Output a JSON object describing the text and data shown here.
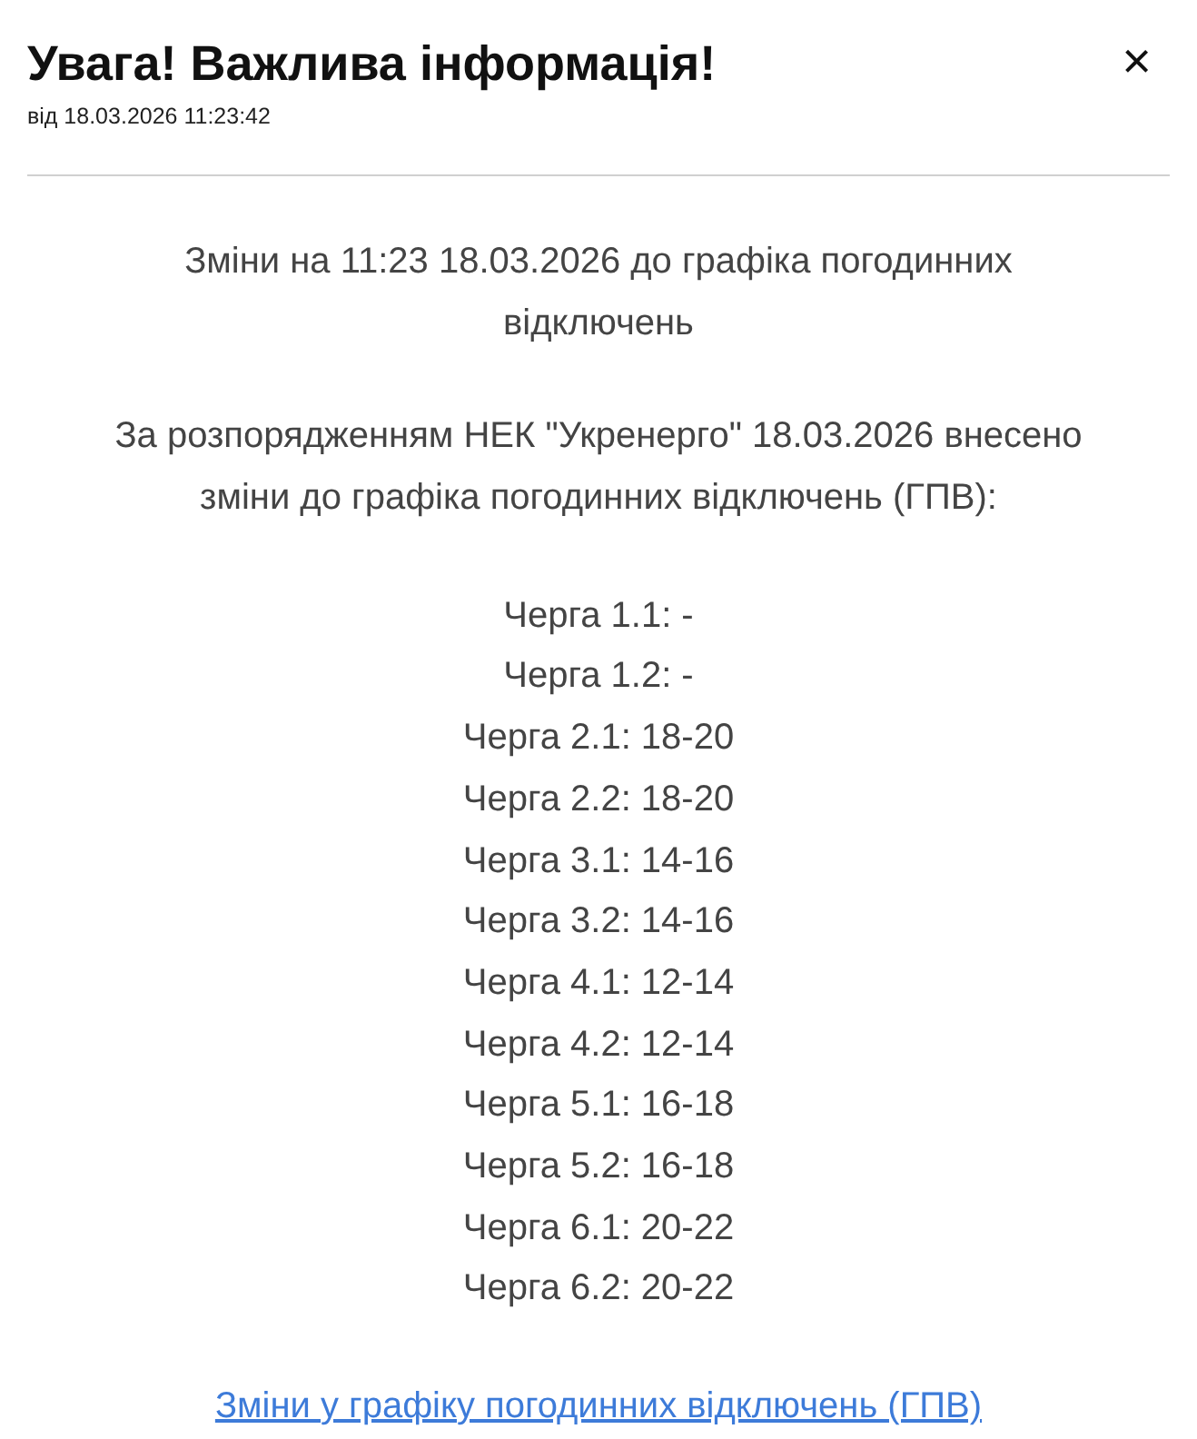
{
  "title": "Увага! Важлива інформація!",
  "close": "×",
  "date": "від 18.03.2026 11:23:42",
  "heading": "Зміни на 11:23 18.03.2026 до графіка погодинних відключень",
  "intro": "За розпорядженням НЕК \"Укренерго\" 18.03.2026 внесено зміни до графіка погодинних відключень (ГПВ):",
  "queues": [
    "Черга 1.1: -",
    "Черга 1.2: -",
    "Черга 2.1: 18-20",
    "Черга 2.2: 18-20",
    "Черга 3.1: 14-16",
    "Черга 3.2: 14-16",
    "Черга 4.1: 12-14",
    "Черга 4.2: 12-14",
    "Черга 5.1: 16-18",
    "Черга 5.2: 16-18",
    "Черга 6.1: 20-22",
    "Черга 6.2: 20-22"
  ],
  "link": "Зміни у графіку погодинних відключень (ГПВ)"
}
